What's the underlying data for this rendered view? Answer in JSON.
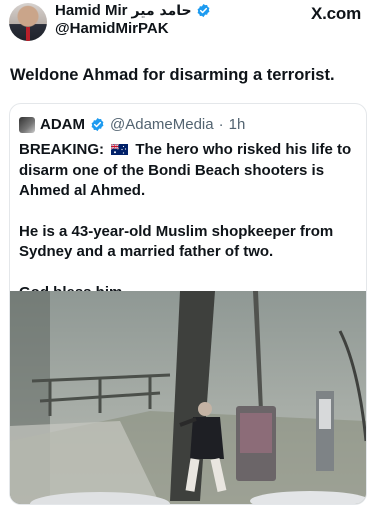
{
  "author": {
    "name": "Hamid Mir",
    "name_urdu": "حامد میر",
    "handle": "@HamidMirPAK",
    "verified": true
  },
  "site": "X.com",
  "tweet": {
    "text": "Weldone Ahmad for disarming a terrorist."
  },
  "quoted": {
    "name": "ADAM",
    "handle": "@AdameMedia",
    "separator": "·",
    "time": "1h",
    "verified": true,
    "breaking_label": "BREAKING:",
    "flag_icon": "australia-flag-icon",
    "breaking_text": "The hero who risked his life to disarm one of the Bondi Beach shooters is Ahmed al Ahmed.",
    "paragraph2": "He is a 43-year-old Muslim shopkeeper from Sydney and a married father of two.",
    "paragraph3": "God bless him."
  },
  "colors": {
    "verified_blue": "#1d9bf0",
    "text": "#0f1419",
    "muted": "#536471",
    "border": "#e4e7ea"
  }
}
